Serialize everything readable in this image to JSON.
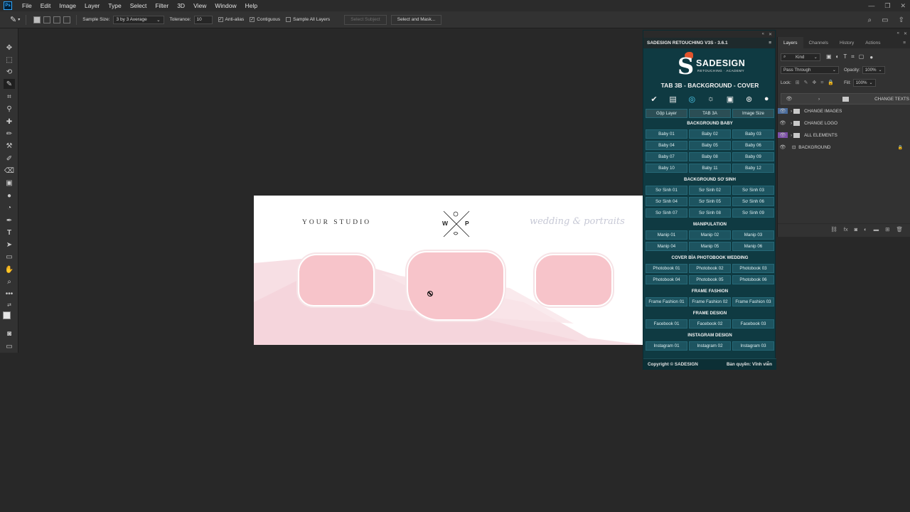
{
  "menu": {
    "app_icon": "Ps",
    "items": [
      "File",
      "Edit",
      "Image",
      "Layer",
      "Type",
      "Select",
      "Filter",
      "3D",
      "View",
      "Window",
      "Help"
    ]
  },
  "options": {
    "sample_size_label": "Sample Size:",
    "sample_size_value": "3 by 3 Average",
    "tolerance_label": "Tolerance:",
    "tolerance_value": "10",
    "anti_alias": "Anti-alias",
    "contiguous": "Contiguous",
    "sample_all_layers": "Sample All Layers",
    "select_subject": "Select Subject",
    "select_and_mask": "Select and Mask..."
  },
  "canvas": {
    "studio_text": "YOUR STUDIO",
    "monogram_left": "W",
    "monogram_right": "P",
    "script_text": "wedding & portraits"
  },
  "plugin": {
    "title": "SADESIGN RETOUCHING V3S - 3.6.1",
    "logo_text": "SADESIGN",
    "logo_sub": "RETOUCHING · ACADEMY",
    "tab_title": "TAB 3B - BACKGROUND - COVER",
    "top_buttons": [
      "Gộp Layer",
      "TAB 3A",
      "Image Size"
    ],
    "sections": [
      {
        "title": "BACKGROUND BABY",
        "buttons": [
          "Baby 01",
          "Baby 02",
          "Baby 03",
          "Baby 04",
          "Baby 05",
          "Baby 06",
          "Baby 07",
          "Baby 08",
          "Baby 09",
          "Baby 10",
          "Baby 11",
          "Baby 12"
        ]
      },
      {
        "title": "BACKGROUND SƠ SINH",
        "buttons": [
          "Sơ Sinh 01",
          "Sơ Sinh 02",
          "Sơ Sinh 03",
          "Sơ Sinh 04",
          "Sơ Sinh 05",
          "Sơ Sinh 06",
          "Sơ Sinh 07",
          "Sơ Sinh 08",
          "Sơ Sinh 09"
        ]
      },
      {
        "title": "MANIPULATION",
        "buttons": [
          "Manip 01",
          "Manip 02",
          "Manip 03",
          "Manip 04",
          "Manip 05",
          "Manip 06"
        ]
      },
      {
        "title": "COVER BÌA PHOTOBOOK WEDDING",
        "buttons": [
          "Photobook 01",
          "Photobook 02",
          "Photobook 03",
          "Photobook 04",
          "Photobook 05",
          "Photobook 06"
        ]
      },
      {
        "title": "FRAME FASHION",
        "buttons": [
          "Frame Fashion 01",
          "Frame Fashion 02",
          "Frame Fashion 03"
        ]
      },
      {
        "title": "FRAME DESIGN",
        "buttons": [
          "Facebook 01",
          "Facebook 02",
          "Facebook 03"
        ]
      },
      {
        "title": "INSTAGRAM DESIGN",
        "buttons": [
          "Instagram 01",
          "Instagram 02",
          "Instagram 03"
        ]
      }
    ],
    "footer_left": "Copyright © SADESIGN",
    "footer_right": "Bản quyền: Vĩnh viễn",
    "colors": {
      "panel_bg": "#0f3a42",
      "button_bg": "#1d5460",
      "accent_icon": "#4fd0f5"
    }
  },
  "layers_panel": {
    "tabs": [
      "Layers",
      "Channels",
      "History",
      "Actions"
    ],
    "kind_filter": "Kind",
    "blend_mode": "Pass Through",
    "opacity_label": "Opacity:",
    "opacity_value": "100%",
    "lock_label": "Lock:",
    "fill_label": "Fill:",
    "fill_value": "100%",
    "layers": [
      {
        "name": "CHANGE TEXTS",
        "type": "group",
        "color": "none"
      },
      {
        "name": "CHANGE IMAGES",
        "type": "group",
        "color": "#4a6c9c"
      },
      {
        "name": "CHANGE LOGO",
        "type": "group",
        "color": "none"
      },
      {
        "name": "ALL ELEMENTS",
        "type": "group",
        "color": "#7d4fa8"
      },
      {
        "name": "BACKGROUND",
        "type": "artboard",
        "color": "none"
      }
    ]
  }
}
